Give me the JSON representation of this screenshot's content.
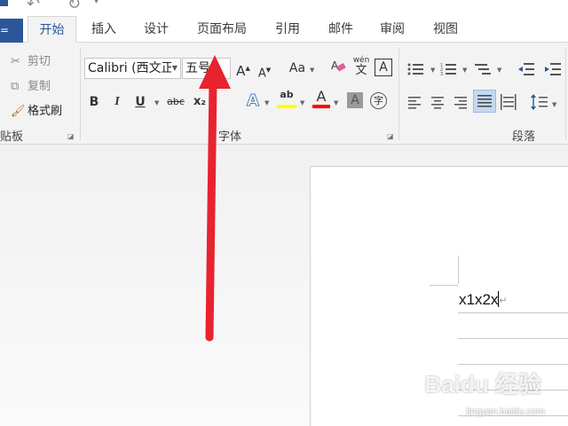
{
  "tabs": {
    "file": "=",
    "items": [
      "开始",
      "插入",
      "设计",
      "页面布局",
      "引用",
      "邮件",
      "审阅",
      "视图"
    ]
  },
  "clipboard": {
    "cut": "剪切",
    "copy": "复制",
    "format_painter": "格式刷",
    "group_label": "贴板"
  },
  "font": {
    "font_name": "Calibri (西文正",
    "font_size": "五号",
    "group_label": "字体",
    "grow": "A",
    "shrink": "A",
    "change_case": "Aa",
    "phonetic_top": "wén",
    "phonetic_bottom": "文",
    "border_char": "A",
    "bold": "B",
    "italic": "I",
    "underline": "U",
    "strikethrough": "abc",
    "subscript": "x₂",
    "text_effect": "A",
    "highlight": "ab",
    "font_color": "A",
    "char_shade": "A",
    "enclose": "字"
  },
  "paragraph": {
    "group_label": "段落"
  },
  "document": {
    "text": "x1x2x",
    "pilcrow": "↵"
  },
  "watermark": {
    "brand": "Baidu 经验",
    "url": "jingyan.baidu.com"
  },
  "colors": {
    "accent": "#2b579a",
    "arrow": "#e8232f",
    "highlight_bar": "#ffff00",
    "font_color_bar": "#ff0000"
  }
}
